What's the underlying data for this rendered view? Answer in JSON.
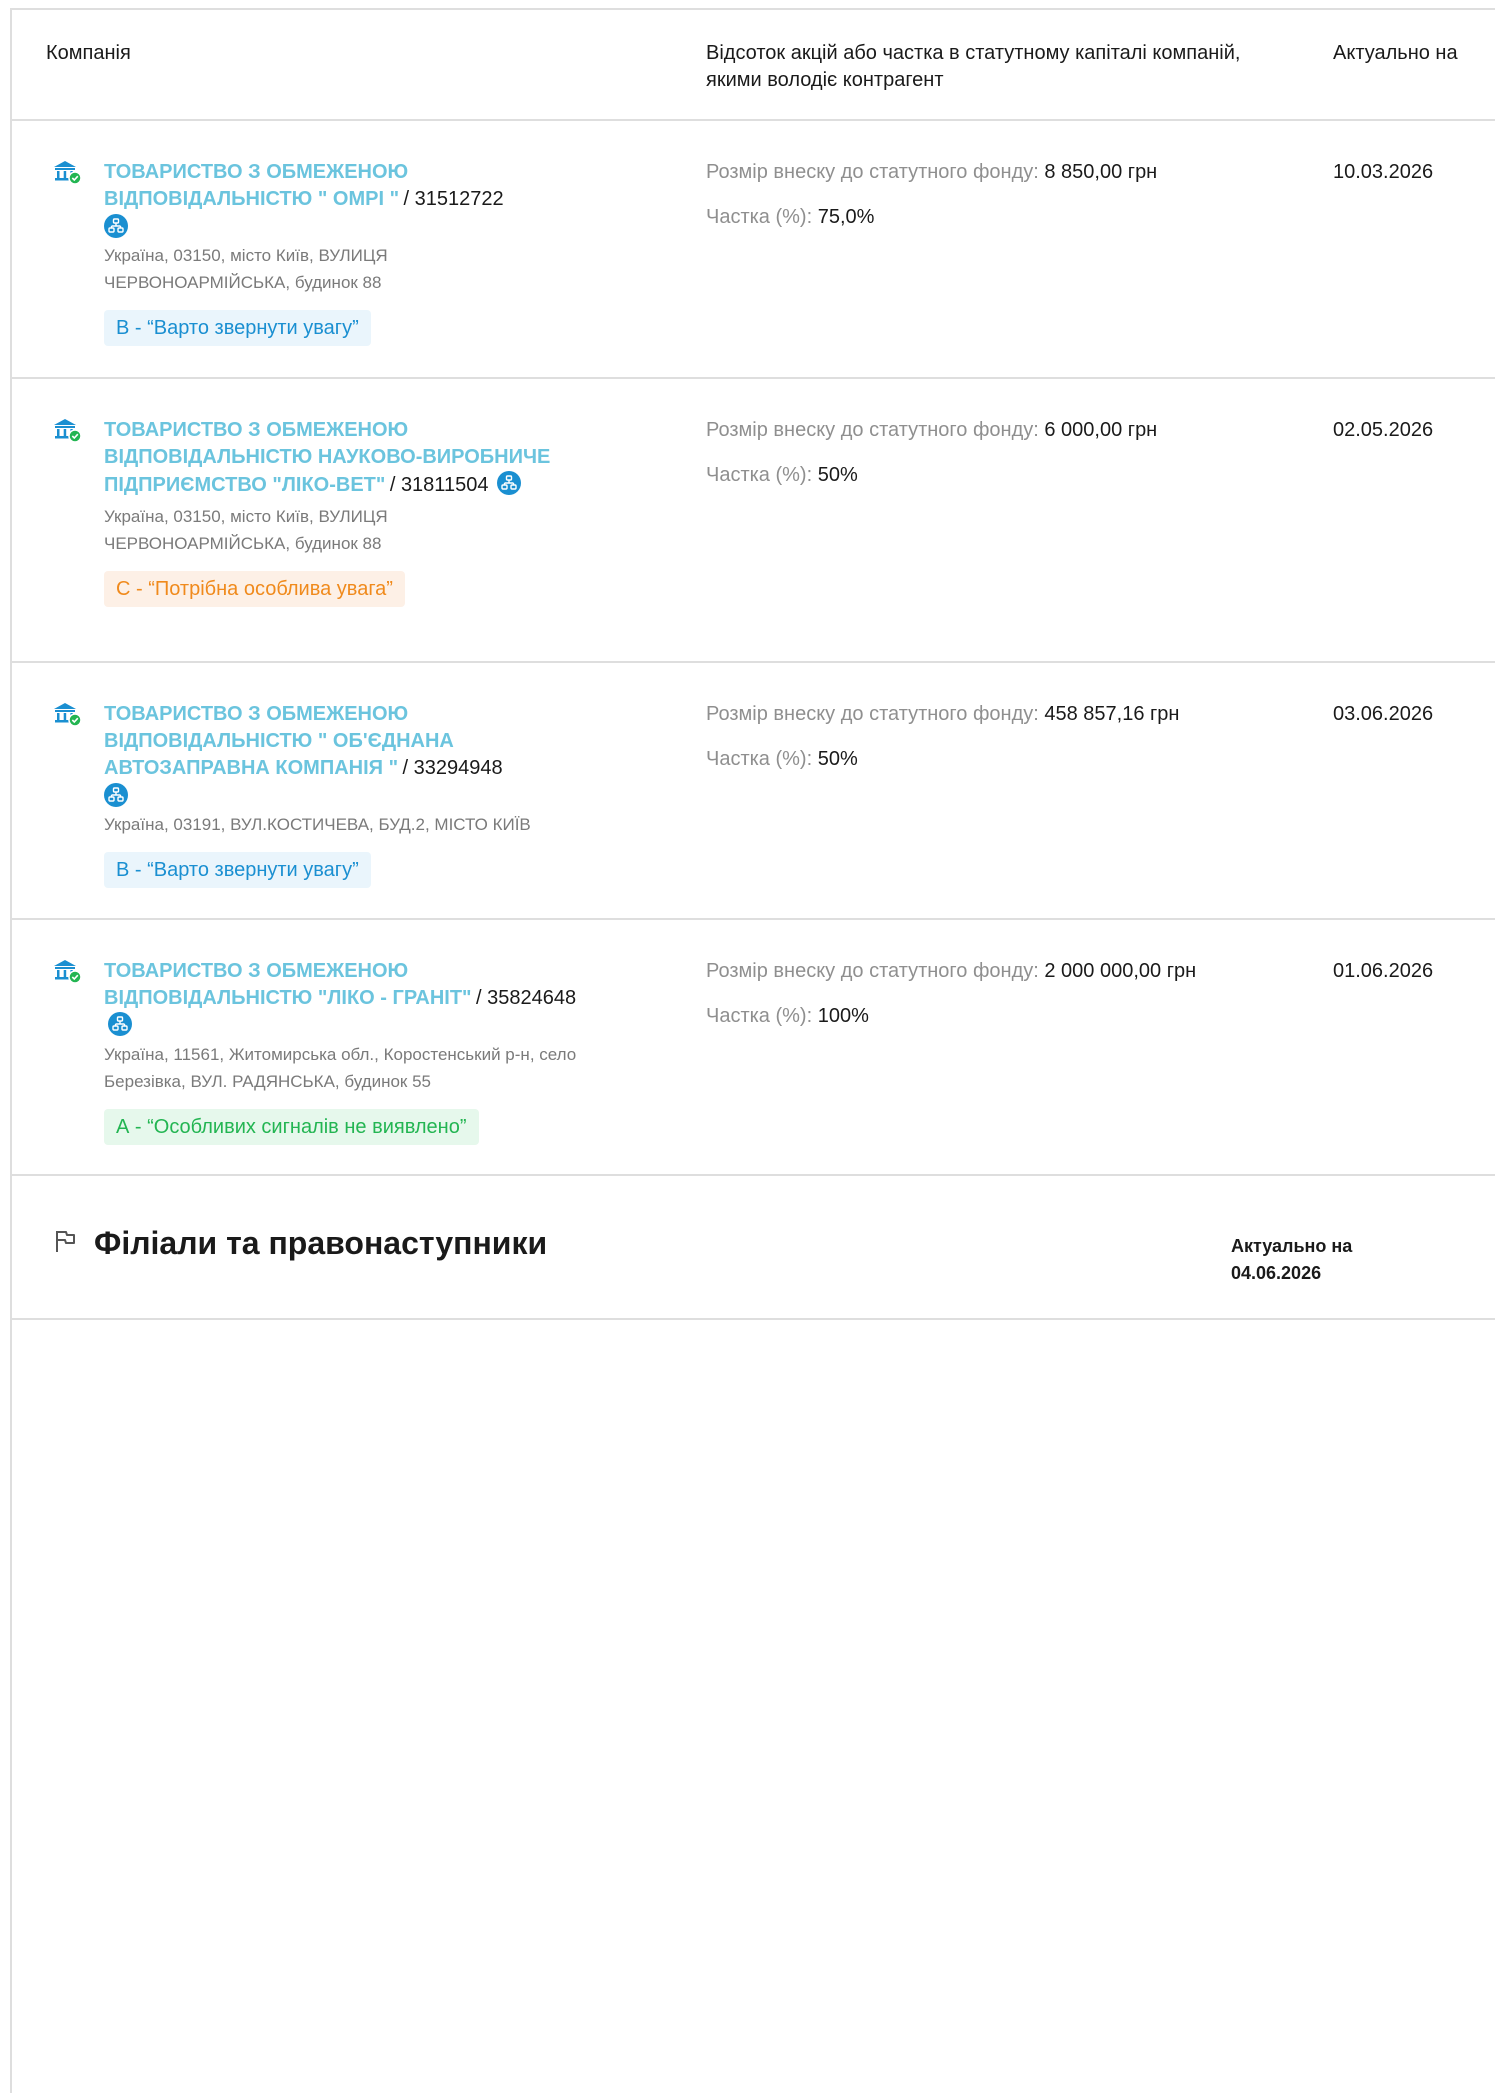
{
  "table": {
    "headers": {
      "company": "Компанія",
      "share": "Відсоток акцій або частка в статутному капіталі компаній, якими володіє контрагент",
      "date": "Актуально на"
    },
    "share_label": "Розмір внеску до статутного фонду:",
    "percent_label": "Частка (%):",
    "rows": [
      {
        "name": "ТОВАРИСТВО З ОБМЕЖЕНОЮ ВІДПОВІДАЛЬНІСТЮ \" ОМРІ \"",
        "code": "31512722",
        "address": "Україна, 03150, місто Київ, ВУЛИЦЯ ЧЕРВОНОАРМІЙСЬКА, будинок 88",
        "badge": "В - “Варто звернути увагу”",
        "contribution": "8 850,00 грн",
        "percent": "75,0%",
        "date": "10.03.2026"
      },
      {
        "name": "ТОВАРИСТВО З ОБМЕЖЕНОЮ ВІДПОВІДАЛЬНІСТЮ НАУКОВО-ВИРОБНИЧЕ ПІДПРИЄМСТВО \"ЛІКО-ВЕТ\"",
        "code": "31811504",
        "address": "Україна, 03150, місто Київ, ВУЛИЦЯ ЧЕРВОНОАРМІЙСЬКА, будинок 88",
        "badge": "С - “Потрібна особлива увага”",
        "contribution": "6 000,00 грн",
        "percent": "50%",
        "date": "02.05.2026"
      },
      {
        "name": "ТОВАРИСТВО З ОБМЕЖЕНОЮ ВІДПОВІДАЛЬНІСТЮ \" ОБ'ЄДНАНА АВТОЗАПРАВНА КОМПАНІЯ \"",
        "code": "33294948",
        "address": "Україна, 03191, ВУЛ.КОСТИЧЕВА, БУД.2, МІСТО КИЇВ",
        "badge": "В - “Варто звернути увагу”",
        "contribution": "458 857,16 грн",
        "percent": "50%",
        "date": "03.06.2026"
      },
      {
        "name": "ТОВАРИСТВО З ОБМЕЖЕНОЮ ВІДПОВІДАЛЬНІСТЮ \"ЛІКО - ГРАНІТ\"",
        "code": "35824648",
        "address": "Україна, 11561, Житомирська обл., Коростенський р-н, село Березівка, ВУЛ. РАДЯНСЬКА, будинок 55",
        "badge": "А - “Особливих сигналів не виявлено”",
        "contribution": "2 000 000,00 грн",
        "percent": "100%",
        "date": "01.06.2026"
      }
    ]
  },
  "branches": {
    "title": "Філіали та правонаступники",
    "actual_label": "Актуально на",
    "actual_date": "04.06.2026"
  },
  "colors": {
    "link": "#6bc4de",
    "badge_b": "#1a8fd1",
    "badge_c": "#f08a1c",
    "badge_a": "#23b552",
    "border": "#dedede"
  },
  "icons": [
    "bank-verified-icon",
    "company-tree-icon",
    "flag-icon"
  ]
}
